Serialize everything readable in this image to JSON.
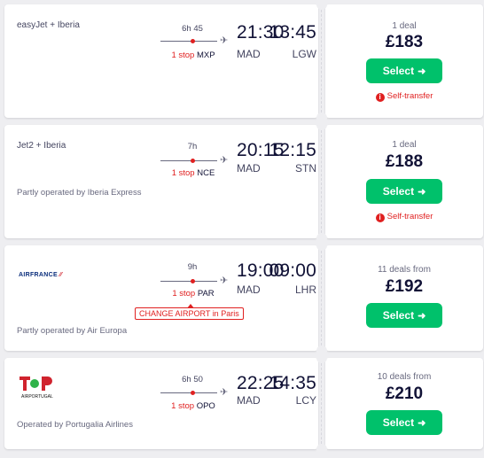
{
  "results": [
    {
      "airline": "easyJet + Iberia",
      "dep_time": "13:45",
      "dep_code": "LGW",
      "arr_time": "21:30",
      "arr_code": "MAD",
      "duration": "6h 45",
      "stops_label": "1 stop",
      "stop_airport": "MXP",
      "operated": "",
      "deals": "1 deal",
      "price": "£183",
      "select": "Select",
      "warning": "Self-transfer"
    },
    {
      "airline": "Jet2 + Iberia",
      "dep_time": "12:15",
      "dep_code": "STN",
      "arr_time": "20:15",
      "arr_code": "MAD",
      "duration": "7h",
      "stops_label": "1 stop",
      "stop_airport": "NCE",
      "operated": "Partly operated by Iberia Express",
      "deals": "1 deal",
      "price": "£188",
      "select": "Select",
      "warning": "Self-transfer"
    },
    {
      "airline": "",
      "logo_text": "AIRFRANCE",
      "dep_time": "09:00",
      "dep_code": "LHR",
      "arr_time": "19:00",
      "arr_code": "MAD",
      "duration": "9h",
      "stops_label": "1 stop",
      "stop_airport": "PAR",
      "change_airport": "CHANGE AIRPORT in Paris",
      "operated": "Partly operated by Air Europa",
      "deals": "11 deals from",
      "price": "£192",
      "select": "Select"
    },
    {
      "airline": "",
      "logo_text": "AIRPORTUGAL",
      "dep_time": "14:35",
      "dep_code": "LCY",
      "arr_time": "22:25",
      "arr_code": "MAD",
      "duration": "6h 50",
      "stops_label": "1 stop",
      "stop_airport": "OPO",
      "operated": "Operated by Portugalia Airlines",
      "deals": "10 deals from",
      "price": "£210",
      "select": "Select"
    }
  ],
  "colors": {
    "accent": "#00c16b",
    "warning": "#e02020",
    "text": "#111236"
  }
}
